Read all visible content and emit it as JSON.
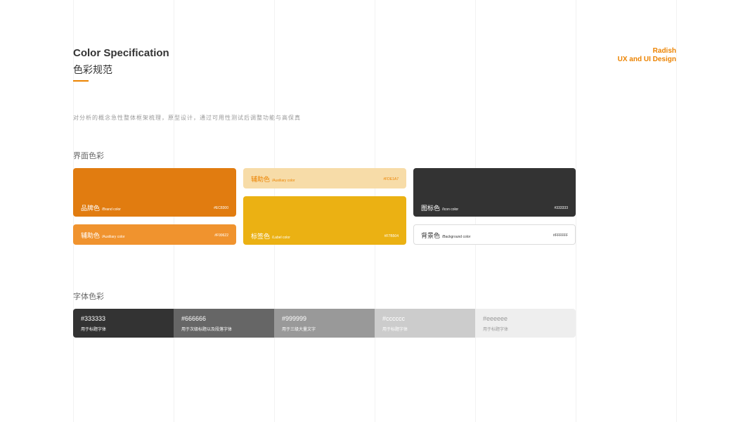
{
  "header": {
    "title_en": "Color Specification",
    "title_cn": "色彩规范",
    "brand_line1": "Radish",
    "brand_line2": "UX and UI Design",
    "description": "对分析的概念急性整体框架梳理，原型设计，通过可用性测试后调整功能与高保真"
  },
  "colors": {
    "brand": "#EC8300",
    "text_dark": "#333333"
  },
  "interface_colors": {
    "section_title": "界面色彩",
    "brand": {
      "name": "品牌色",
      "sub": "/Brand color",
      "hex": "#EC8300"
    },
    "aux1": {
      "name": "辅助色",
      "sub": "/Auxiliary color",
      "hex": "#F99622"
    },
    "aux2": {
      "name": "辅助色",
      "sub": "/Auxiliary color",
      "hex": "#FDE1A7"
    },
    "label": {
      "name": "标签色",
      "sub": "/Label color",
      "hex": "#F7B504"
    },
    "icon": {
      "name": "图标色",
      "sub": "/Icon color",
      "hex": "#333333"
    },
    "background": {
      "name": "背景色",
      "sub": "/Background color",
      "hex": "#FFFFFF"
    }
  },
  "font_colors": {
    "section_title": "字体色彩",
    "items": [
      {
        "hex": "#333333",
        "usage": "用于标题字体"
      },
      {
        "hex": "#666666",
        "usage": "用于次级标题以及段落字体"
      },
      {
        "hex": "#999999",
        "usage": "用于三级大量文字"
      },
      {
        "hex": "#cccccc",
        "usage": "用于标题字体"
      },
      {
        "hex": "#eeeeee",
        "usage": "用于标题字体"
      }
    ]
  }
}
